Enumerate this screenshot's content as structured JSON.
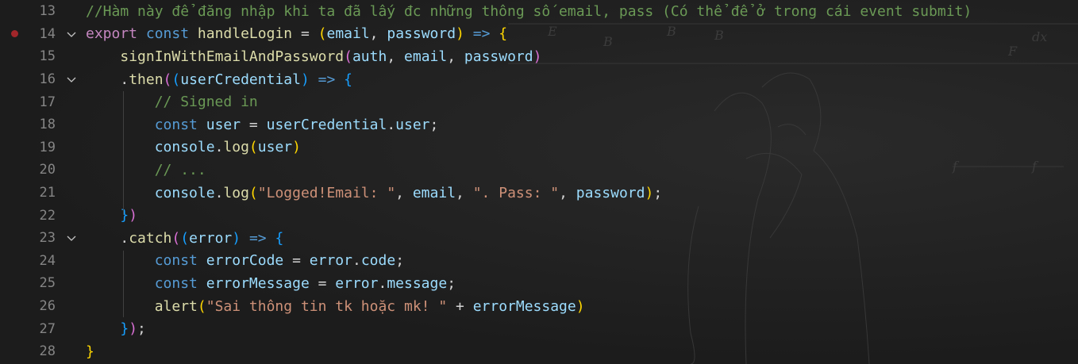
{
  "editor": {
    "lines": [
      {
        "num": "13",
        "segments": [
          {
            "t": "//Hàm này để đăng nhập khi ta đã lấy đc những thông số email, pass (Có thể để ở trong cái event submit)",
            "c": "cm"
          }
        ]
      },
      {
        "num": "14",
        "breakpoint": true,
        "fold": true,
        "segments": [
          {
            "t": "export",
            "c": "kwc"
          },
          {
            "t": " ",
            "c": "op"
          },
          {
            "t": "const",
            "c": "kw"
          },
          {
            "t": " ",
            "c": "op"
          },
          {
            "t": "handleLogin",
            "c": "fn"
          },
          {
            "t": " = ",
            "c": "op"
          },
          {
            "t": "(",
            "c": "p1"
          },
          {
            "t": "email",
            "c": "var"
          },
          {
            "t": ", ",
            "c": "op"
          },
          {
            "t": "password",
            "c": "var"
          },
          {
            "t": ")",
            "c": "p1"
          },
          {
            "t": " ",
            "c": "op"
          },
          {
            "t": "=>",
            "c": "kw"
          },
          {
            "t": " ",
            "c": "op"
          },
          {
            "t": "{",
            "c": "p1"
          }
        ]
      },
      {
        "num": "15",
        "segments": [
          {
            "t": "    ",
            "c": "op"
          },
          {
            "t": "signInWithEmailAndPassword",
            "c": "fn"
          },
          {
            "t": "(",
            "c": "p2"
          },
          {
            "t": "auth",
            "c": "var"
          },
          {
            "t": ", ",
            "c": "op"
          },
          {
            "t": "email",
            "c": "var"
          },
          {
            "t": ", ",
            "c": "op"
          },
          {
            "t": "password",
            "c": "var"
          },
          {
            "t": ")",
            "c": "p2"
          }
        ]
      },
      {
        "num": "16",
        "fold": true,
        "segments": [
          {
            "t": "    .",
            "c": "op"
          },
          {
            "t": "then",
            "c": "fn"
          },
          {
            "t": "(",
            "c": "p2"
          },
          {
            "t": "(",
            "c": "p3"
          },
          {
            "t": "userCredential",
            "c": "var"
          },
          {
            "t": ")",
            "c": "p3"
          },
          {
            "t": " ",
            "c": "op"
          },
          {
            "t": "=>",
            "c": "kw"
          },
          {
            "t": " ",
            "c": "op"
          },
          {
            "t": "{",
            "c": "p3"
          }
        ]
      },
      {
        "num": "17",
        "segments": [
          {
            "t": "        ",
            "c": "op"
          },
          {
            "t": "// Signed in",
            "c": "cm"
          }
        ]
      },
      {
        "num": "18",
        "segments": [
          {
            "t": "        ",
            "c": "op"
          },
          {
            "t": "const",
            "c": "kw"
          },
          {
            "t": " ",
            "c": "op"
          },
          {
            "t": "user",
            "c": "var"
          },
          {
            "t": " = ",
            "c": "op"
          },
          {
            "t": "userCredential",
            "c": "var"
          },
          {
            "t": ".",
            "c": "op"
          },
          {
            "t": "user",
            "c": "var"
          },
          {
            "t": ";",
            "c": "op"
          }
        ]
      },
      {
        "num": "19",
        "segments": [
          {
            "t": "        ",
            "c": "op"
          },
          {
            "t": "console",
            "c": "var"
          },
          {
            "t": ".",
            "c": "op"
          },
          {
            "t": "log",
            "c": "fn"
          },
          {
            "t": "(",
            "c": "p1"
          },
          {
            "t": "user",
            "c": "var"
          },
          {
            "t": ")",
            "c": "p1"
          }
        ]
      },
      {
        "num": "20",
        "segments": [
          {
            "t": "        ",
            "c": "op"
          },
          {
            "t": "// ...",
            "c": "cm"
          }
        ]
      },
      {
        "num": "21",
        "segments": [
          {
            "t": "        ",
            "c": "op"
          },
          {
            "t": "console",
            "c": "var"
          },
          {
            "t": ".",
            "c": "op"
          },
          {
            "t": "log",
            "c": "fn"
          },
          {
            "t": "(",
            "c": "p1"
          },
          {
            "t": "\"Logged!Email: \"",
            "c": "str"
          },
          {
            "t": ", ",
            "c": "op"
          },
          {
            "t": "email",
            "c": "var"
          },
          {
            "t": ", ",
            "c": "op"
          },
          {
            "t": "\". Pass: \"",
            "c": "str"
          },
          {
            "t": ", ",
            "c": "op"
          },
          {
            "t": "password",
            "c": "var"
          },
          {
            "t": ")",
            "c": "p1"
          },
          {
            "t": ";",
            "c": "op"
          }
        ]
      },
      {
        "num": "22",
        "segments": [
          {
            "t": "    ",
            "c": "op"
          },
          {
            "t": "}",
            "c": "p3"
          },
          {
            "t": ")",
            "c": "p2"
          }
        ]
      },
      {
        "num": "23",
        "fold": true,
        "segments": [
          {
            "t": "    .",
            "c": "op"
          },
          {
            "t": "catch",
            "c": "fn"
          },
          {
            "t": "(",
            "c": "p2"
          },
          {
            "t": "(",
            "c": "p3"
          },
          {
            "t": "error",
            "c": "var"
          },
          {
            "t": ")",
            "c": "p3"
          },
          {
            "t": " ",
            "c": "op"
          },
          {
            "t": "=>",
            "c": "kw"
          },
          {
            "t": " ",
            "c": "op"
          },
          {
            "t": "{",
            "c": "p3"
          }
        ]
      },
      {
        "num": "24",
        "segments": [
          {
            "t": "        ",
            "c": "op"
          },
          {
            "t": "const",
            "c": "kw"
          },
          {
            "t": " ",
            "c": "op"
          },
          {
            "t": "errorCode",
            "c": "var"
          },
          {
            "t": " = ",
            "c": "op"
          },
          {
            "t": "error",
            "c": "var"
          },
          {
            "t": ".",
            "c": "op"
          },
          {
            "t": "code",
            "c": "var"
          },
          {
            "t": ";",
            "c": "op"
          }
        ]
      },
      {
        "num": "25",
        "segments": [
          {
            "t": "        ",
            "c": "op"
          },
          {
            "t": "const",
            "c": "kw"
          },
          {
            "t": " ",
            "c": "op"
          },
          {
            "t": "errorMessage",
            "c": "var"
          },
          {
            "t": " = ",
            "c": "op"
          },
          {
            "t": "error",
            "c": "var"
          },
          {
            "t": ".",
            "c": "op"
          },
          {
            "t": "message",
            "c": "var"
          },
          {
            "t": ";",
            "c": "op"
          }
        ]
      },
      {
        "num": "26",
        "segments": [
          {
            "t": "        ",
            "c": "op"
          },
          {
            "t": "alert",
            "c": "fn"
          },
          {
            "t": "(",
            "c": "p1"
          },
          {
            "t": "\"Sai thông tin tk hoặc mk! \"",
            "c": "str"
          },
          {
            "t": " + ",
            "c": "op"
          },
          {
            "t": "errorMessage",
            "c": "var"
          },
          {
            "t": ")",
            "c": "p1"
          }
        ]
      },
      {
        "num": "27",
        "segments": [
          {
            "t": "    ",
            "c": "op"
          },
          {
            "t": "}",
            "c": "p3"
          },
          {
            "t": ")",
            "c": "p2"
          },
          {
            "t": ";",
            "c": "op"
          }
        ]
      },
      {
        "num": "28",
        "segments": [
          {
            "t": "}",
            "c": "p1"
          }
        ]
      }
    ]
  },
  "colors": {
    "background": "#1e1e1e",
    "line_number": "#858585",
    "breakpoint": "#a1262a",
    "comment": "#6a9955",
    "keyword": "#569cd6",
    "function": "#dcdcaa",
    "variable": "#9cdcfe",
    "string": "#ce9178"
  },
  "icons": {
    "breakpoint": "breakpoint-dot-icon",
    "fold": "chevron-down-icon"
  }
}
